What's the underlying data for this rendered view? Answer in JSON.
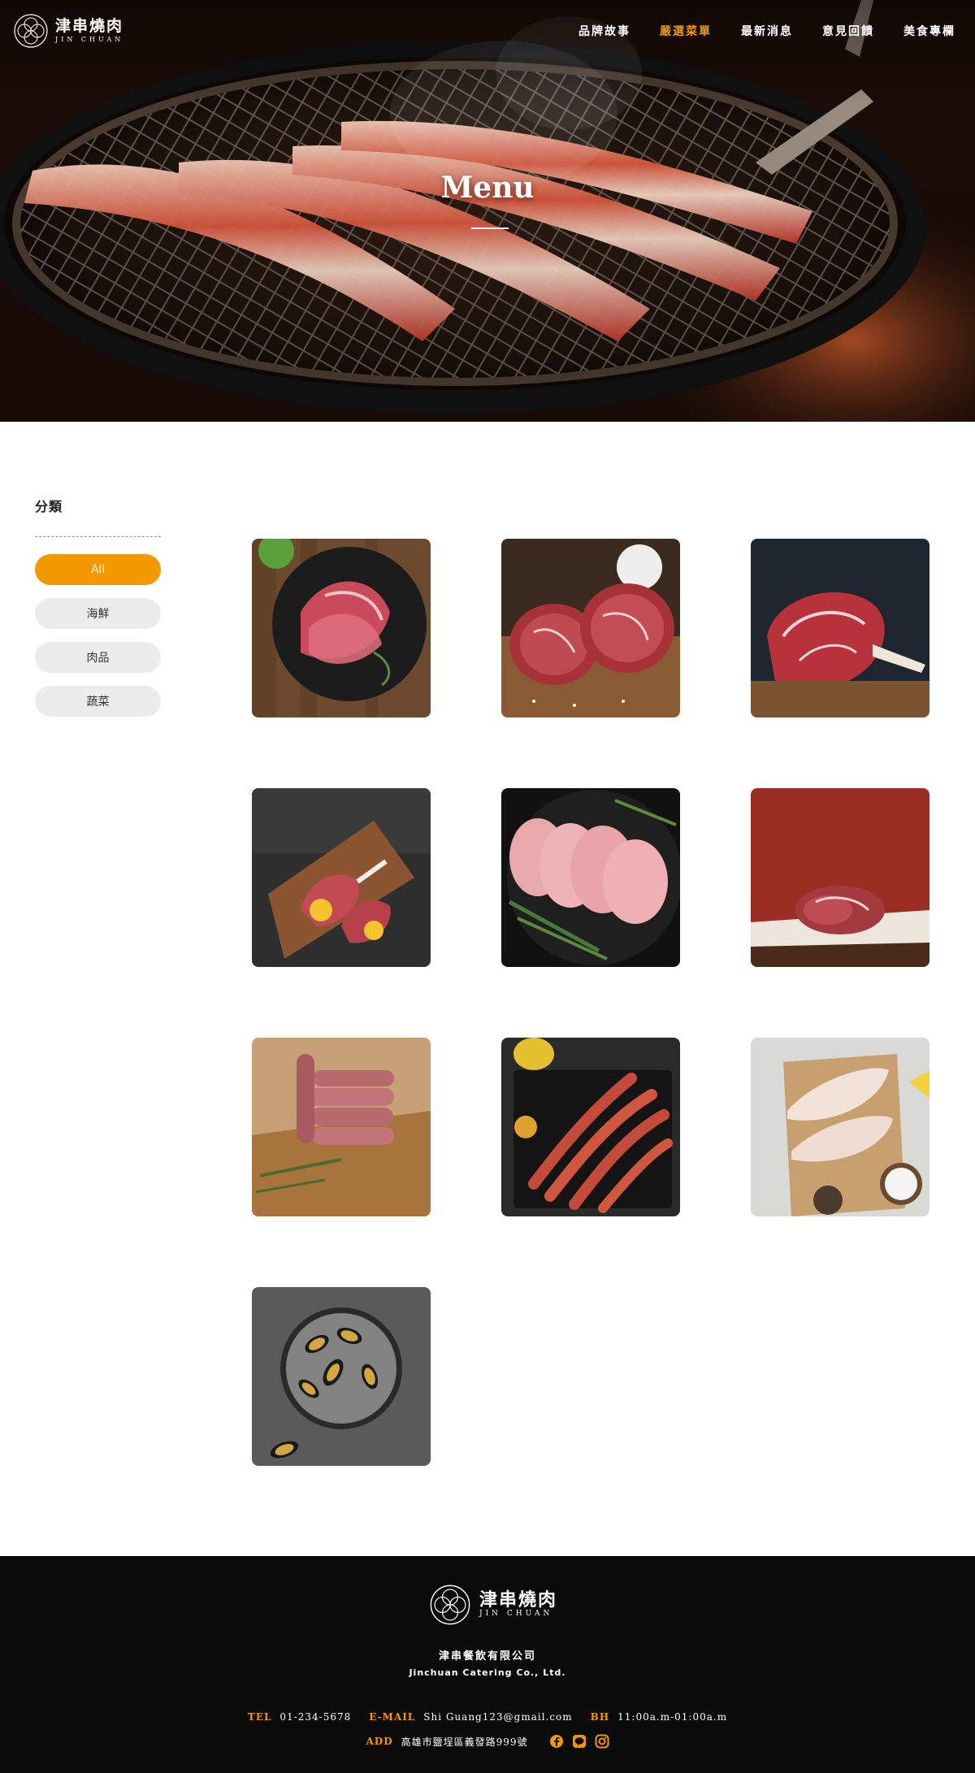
{
  "brand": {
    "name_cn": "津串燒肉",
    "name_en": "JIN CHUAN"
  },
  "nav": {
    "items": [
      {
        "label": "品牌故事",
        "active": false
      },
      {
        "label": "嚴選菜單",
        "active": true
      },
      {
        "label": "最新消息",
        "active": false
      },
      {
        "label": "意見回饋",
        "active": false
      },
      {
        "label": "美食專欄",
        "active": false
      }
    ]
  },
  "hero": {
    "title": "Menu"
  },
  "sidebar": {
    "title": "分類",
    "categories": [
      {
        "label": "All",
        "active": true
      },
      {
        "label": "海鮮",
        "active": false
      },
      {
        "label": "肉品",
        "active": false
      },
      {
        "label": "蔬菜",
        "active": false
      }
    ]
  },
  "menu_items": [
    {
      "icon": "prosciutto-photo"
    },
    {
      "icon": "beef-steaks-photo"
    },
    {
      "icon": "tomahawk-steak-photo"
    },
    {
      "icon": "lamb-chops-photo"
    },
    {
      "icon": "pork-loin-slices-photo"
    },
    {
      "icon": "beef-roast-photo"
    },
    {
      "icon": "burger-patties-photo"
    },
    {
      "icon": "octopus-tentacles-photo"
    },
    {
      "icon": "fish-fillet-photo"
    },
    {
      "icon": "mussels-photo"
    }
  ],
  "colors": {
    "accent": "#f39800",
    "footer_bg": "#0b0b0b",
    "chip_bg": "#ececec"
  },
  "footer": {
    "company_cn": "津串餐飲有限公司",
    "company_en": "Jinchuan Catering Co., Ltd.",
    "tel_label": "TEL",
    "tel": "01-234-5678",
    "email_label": "E-MAIL",
    "email": "Shi Guang123@gmail.com",
    "bh_label": "BH",
    "bh": "11:00a.m-01:00a.m",
    "add_label": "ADD",
    "address": "高雄市鹽埕區義發路999號",
    "social": [
      "facebook-icon",
      "line-icon",
      "instagram-icon"
    ]
  }
}
